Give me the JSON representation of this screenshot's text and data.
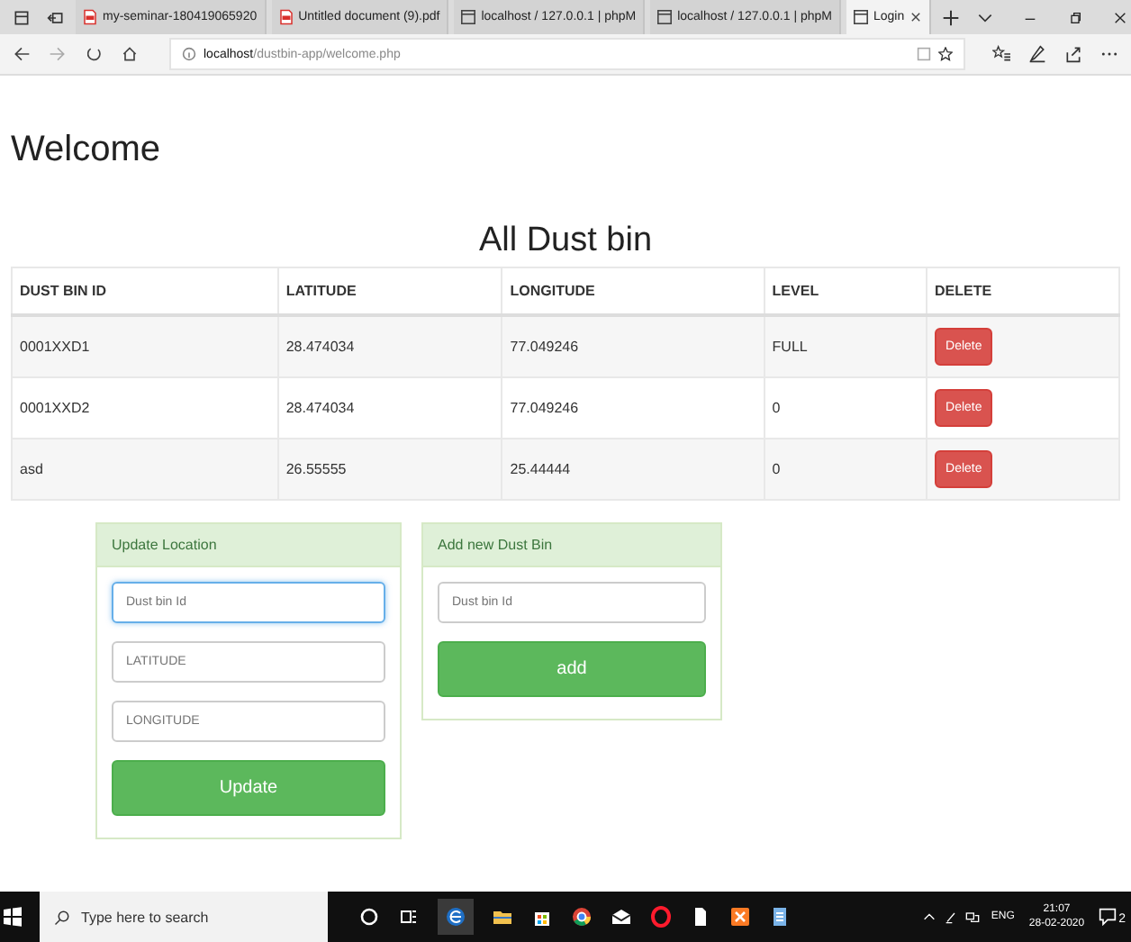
{
  "browser": {
    "tabs": [
      {
        "title": "my-seminar-180419065920",
        "kind": "pdf",
        "selected": false
      },
      {
        "title": "Untitled document (9).pdf",
        "kind": "pdf",
        "selected": false
      },
      {
        "title": "localhost / 127.0.0.1 | phpM",
        "kind": "page",
        "selected": false
      },
      {
        "title": "localhost / 127.0.0.1 | phpM",
        "kind": "page",
        "selected": false
      },
      {
        "title": "Login",
        "kind": "page",
        "selected": true
      }
    ],
    "address": {
      "host": "localhost",
      "path": "/dustbin-app/welcome.php"
    }
  },
  "page": {
    "heading": "Welcome",
    "table": {
      "title": "All Dust bin",
      "columns": [
        "DUST BIN ID",
        "LATITUDE",
        "LONGITUDE",
        "LEVEL",
        "DELETE"
      ],
      "rows": [
        {
          "id": "0001XXD1",
          "latitude": "28.474034",
          "longitude": "77.049246",
          "level": "FULL",
          "action": "Delete"
        },
        {
          "id": "0001XXD2",
          "latitude": "28.474034",
          "longitude": "77.049246",
          "level": "0",
          "action": "Delete"
        },
        {
          "id": "asd",
          "latitude": "26.55555",
          "longitude": "25.44444",
          "level": "0",
          "action": "Delete"
        }
      ]
    },
    "panels": [
      {
        "title": "Update Location",
        "fields": [
          {
            "placeholder": "Dust bin Id",
            "focused": true
          },
          {
            "placeholder": "LATITUDE",
            "focused": false
          },
          {
            "placeholder": "LONGITUDE",
            "focused": false
          }
        ],
        "button": "Update"
      },
      {
        "title": "Add new Dust Bin",
        "fields": [
          {
            "placeholder": "Dust bin Id",
            "focused": false
          }
        ],
        "button": "add"
      }
    ]
  },
  "taskbar": {
    "search": {
      "placeholder": "Type here to search"
    },
    "language": "ENG",
    "time": "21:07",
    "date": "28-02-2020",
    "notifications": "2"
  }
}
